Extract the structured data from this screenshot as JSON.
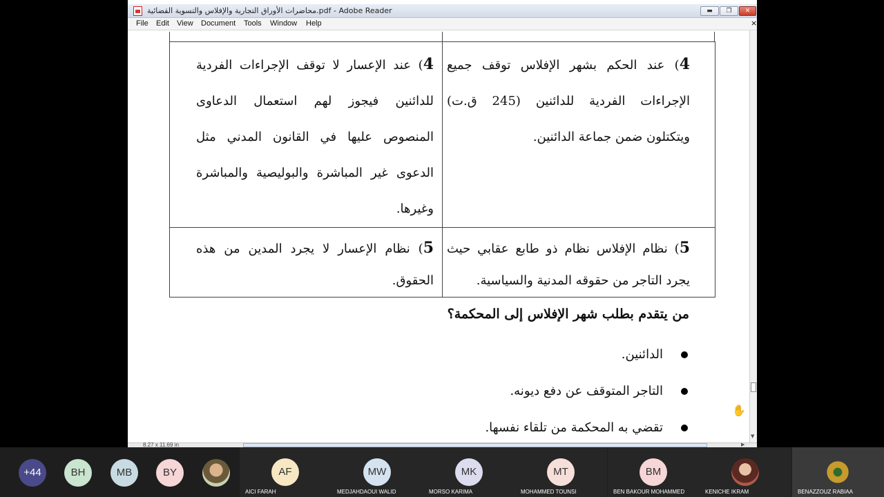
{
  "window": {
    "title": "محاضرات الأوراق التجارية والإفلاس والتسوية القضائية.pdf - Adobe Reader",
    "btn_min": "▬",
    "btn_max": "❐",
    "btn_close": "✕"
  },
  "menu": {
    "items": [
      "File",
      "Edit",
      "View",
      "Document",
      "Tools",
      "Window",
      "Help"
    ],
    "close": "×"
  },
  "document": {
    "rows": [
      {
        "right_num": "4",
        "right_text": ") عند الحكم بشهر الإفلاس توقف جميع الإجراءات الفردية للدائنين (245 ق.ت) ويتكتلون ضمن جماعة الدائنين.",
        "left_num": "4",
        "left_text": ") عند الإعسار لا توقف الإجراءات الفردية للدائنين فيجوز لهم استعمال الدعاوى المنصوص عليها في القانون المدني مثل الدعوى غير المباشرة والبوليصية والمباشرة وغيرها."
      },
      {
        "right_num": "5",
        "right_text": ") نظام الإفلاس نظام ذو طابع عقابي حيث يجرد التاجر من حقوقه المدنية والسياسية.",
        "left_num": "5",
        "left_text": ") نظام الإعسار لا يجرد المدين من هذه الحقوق."
      }
    ],
    "question": "من يتقدم بطلب شهر الإفلاس إلى المحكمة؟",
    "answers": [
      "الدائنين.",
      "التاجر المتوقف عن دفع ديونه.",
      "تقضي به المحكمة من تلقاء نفسها."
    ]
  },
  "status": {
    "page_size": "8.27 x 11.69 in"
  },
  "participants": {
    "more_count": "+44",
    "small": [
      {
        "initials": "BH",
        "color": "#c9e4cf"
      },
      {
        "initials": "MB",
        "color": "#c8dbe3"
      },
      {
        "initials": "BY",
        "color": "#f6d6d6"
      }
    ],
    "tiles": [
      {
        "initials": "AF",
        "name": "AICI FARAH",
        "color": "#f7e7c2"
      },
      {
        "initials": "MW",
        "name": "MEDJAHDAOUI WALID",
        "color": "#d4e3ef"
      },
      {
        "initials": "MK",
        "name": "MORSO KARIMA",
        "color": "#dcdcef"
      },
      {
        "initials": "MT",
        "name": "MOHAMMED TOUNSI",
        "color": "#f7dfd9"
      },
      {
        "initials": "BM",
        "name": "BEN BAKOUR MOHAMMED",
        "color": "#f6d6d6"
      },
      {
        "initials": "",
        "name": "KENICHE IKRAM",
        "color": "#8a4a3a"
      },
      {
        "initials": "",
        "name": "BENAZZOUZ RABIAA",
        "color": "#c79a2c"
      }
    ]
  }
}
